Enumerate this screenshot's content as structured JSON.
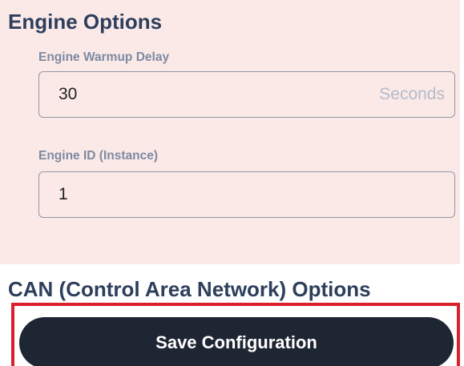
{
  "engine_options": {
    "title": "Engine Options",
    "warmup_delay": {
      "label": "Engine Warmup Delay",
      "value": "30",
      "unit": "Seconds"
    },
    "engine_id": {
      "label": "Engine ID (Instance)",
      "value": "1"
    }
  },
  "can_options": {
    "title": "CAN (Control Area Network) Options"
  },
  "save_button": {
    "label": "Save Configuration"
  },
  "colors": {
    "panel_background": "#fbe9e8",
    "heading_text": "#2e3f5c",
    "button_background": "#1e2633",
    "highlight_border": "#d9202c"
  }
}
